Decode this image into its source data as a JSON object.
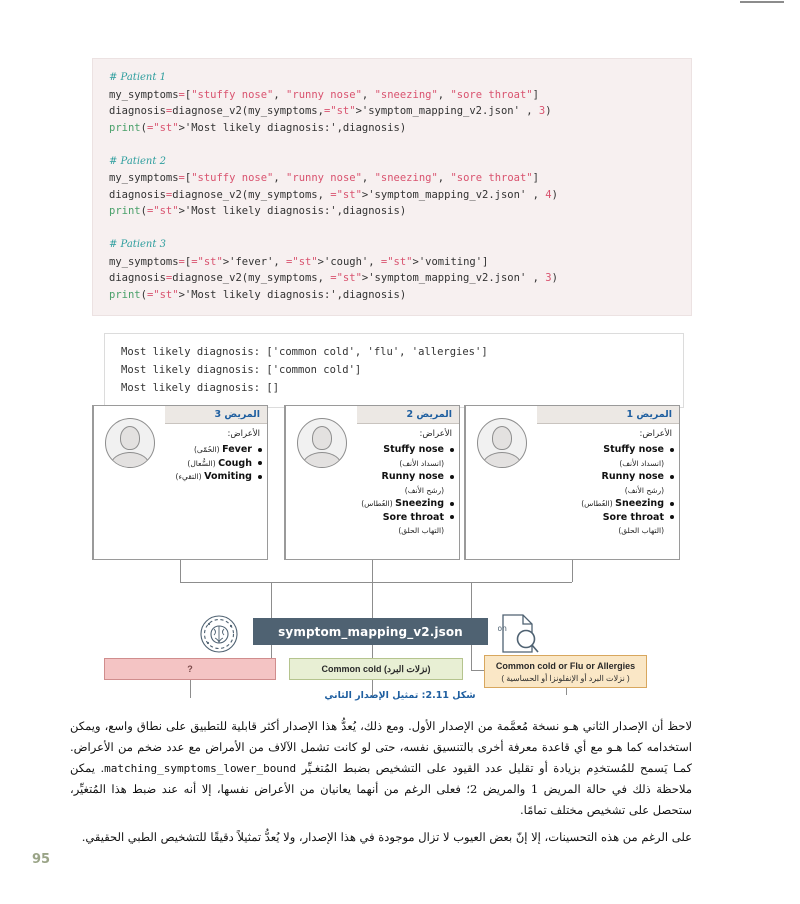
{
  "page": {
    "number": "95"
  },
  "code_block": {
    "lines": [
      {
        "type": "comment",
        "text": "# Patient 1"
      },
      {
        "type": "code",
        "text": "my_symptoms=[\"stuffy nose\", \"runny nose\", \"sneezing\", \"sore throat\"]"
      },
      {
        "type": "code",
        "text": "diagnosis=diagnose_v2(my_symptoms,'symptom_mapping_v2.json' , 3)"
      },
      {
        "type": "code",
        "text": "print('Most likely diagnosis:',diagnosis)"
      },
      {
        "type": "blank",
        "text": ""
      },
      {
        "type": "comment",
        "text": "# Patient 2"
      },
      {
        "type": "code",
        "text": "my_symptoms=[\"stuffy nose\", \"runny nose\", \"sneezing\", \"sore throat\"]"
      },
      {
        "type": "code",
        "text": "diagnosis=diagnose_v2(my_symptoms, 'symptom_mapping_v2.json' , 4)"
      },
      {
        "type": "code",
        "text": "print('Most likely diagnosis:',diagnosis)"
      },
      {
        "type": "blank",
        "text": ""
      },
      {
        "type": "comment",
        "text": "# Patient 3"
      },
      {
        "type": "code",
        "text": "my_symptoms=['fever', 'cough', 'vomiting']"
      },
      {
        "type": "code",
        "text": "diagnosis=diagnose_v2(my_symptoms, 'symptom_mapping_v2.json' , 3)"
      },
      {
        "type": "code",
        "text": "print('Most likely diagnosis:',diagnosis)"
      }
    ]
  },
  "output_block": {
    "lines": [
      "Most likely diagnosis: ['common cold', 'flu', 'allergies']",
      "Most likely diagnosis: ['common cold']",
      "Most likely diagnosis: []"
    ]
  },
  "diagram": {
    "cards": [
      {
        "id": "patient-3",
        "title": "المريض 3",
        "symptoms_label": "الأعراض:",
        "symptoms": [
          {
            "en": "Fever",
            "ar": "(الحُمّى)",
            "inline": true
          },
          {
            "en": "Cough",
            "ar": "(السُّعال)",
            "inline": true
          },
          {
            "en": "Vomiting",
            "ar": "(التقيء)",
            "inline": true
          }
        ]
      },
      {
        "id": "patient-2",
        "title": "المريض 2",
        "symptoms_label": "الأعراض:",
        "symptoms": [
          {
            "en": "Stuffy nose",
            "ar": "(انسداد الأنف)",
            "inline": false
          },
          {
            "en": "Runny nose",
            "ar": "(رشح الأنف)",
            "inline": false
          },
          {
            "en": "Sneezing",
            "ar": "(العُطاس)",
            "inline": true
          },
          {
            "en": "Sore throat",
            "ar": "(التهاب الحلق)",
            "inline": false
          }
        ]
      },
      {
        "id": "patient-1",
        "title": "المريض 1",
        "symptoms_label": "الأعراض:",
        "symptoms": [
          {
            "en": "Stuffy nose",
            "ar": "(انسداد الأنف)",
            "inline": false
          },
          {
            "en": "Runny nose",
            "ar": "(رشح الأنف)",
            "inline": false
          },
          {
            "en": "Sneezing",
            "ar": "(العُطاس)",
            "inline": true
          },
          {
            "en": "Sore throat",
            "ar": "(التهاب الحلق)",
            "inline": false
          }
        ]
      }
    ],
    "mapping_bar": "symptom_mapping_v2.json",
    "json_icon_label": "json",
    "results": {
      "unknown": "?",
      "common_cold_en": "Common cold",
      "common_cold_ar": "(نزلات البرد)",
      "multi_en": "Common cold or Flu or Allergies",
      "multi_ar": "( نزلات البرد أو الإنفلونزا أو الحساسية )"
    },
    "caption": "شكل 2.11: تمثيل الإصدار الثاني"
  },
  "body_paragraphs": [
    "لاحظ أن الإصدار الثاني هـو نسخة مُعمَّمة من الإصدار الأول. ومع ذلك، يُعدُّ هذا الإصدار أكثر قابلية للتطبيق على نطاق واسع، ويمكن استخدامه كما هـو مع أي قاعدة معرفة أخرى بالتنسيق نفسه، حتى لو كانت تشمل الآلاف من الأمراض مع عدد ضخم من الأعراض. كمـا يَسمح للمُستخدِم بزيادة أو تقليل عدد القيود على التشخيص بضبط المُتغـيِّر matching_symptoms_lower_bound. يمكن ملاحظة ذلك في حالة المريض 1 والمريض 2؛ فعلى الرغم من أنهما يعانيان من الأعراض نفسها، إلا أنه عند ضبط هذا المُتغيِّر، ستحصل على تشخيص مختلف تمامًا.",
    "على الرغم من هذه التحسينات، إلا إنّ بعض العيوب لا تزال موجودة في هذا الإصدار، ولا يُعدُّ تمثيلاً دقيقًا للتشخيص الطبي الحقيقي."
  ],
  "colors": {
    "code_bg": "#f7f0f0",
    "comment": "#2e9e9e",
    "string": "#d9536f",
    "function": "#4aa06a",
    "bar": "#4f6272",
    "result_pink": "#f4c4c4",
    "result_green": "#e8efd4",
    "result_orange": "#fae7c6",
    "caption_blue": "#1f5fa0",
    "page_number": "#9aa487"
  }
}
